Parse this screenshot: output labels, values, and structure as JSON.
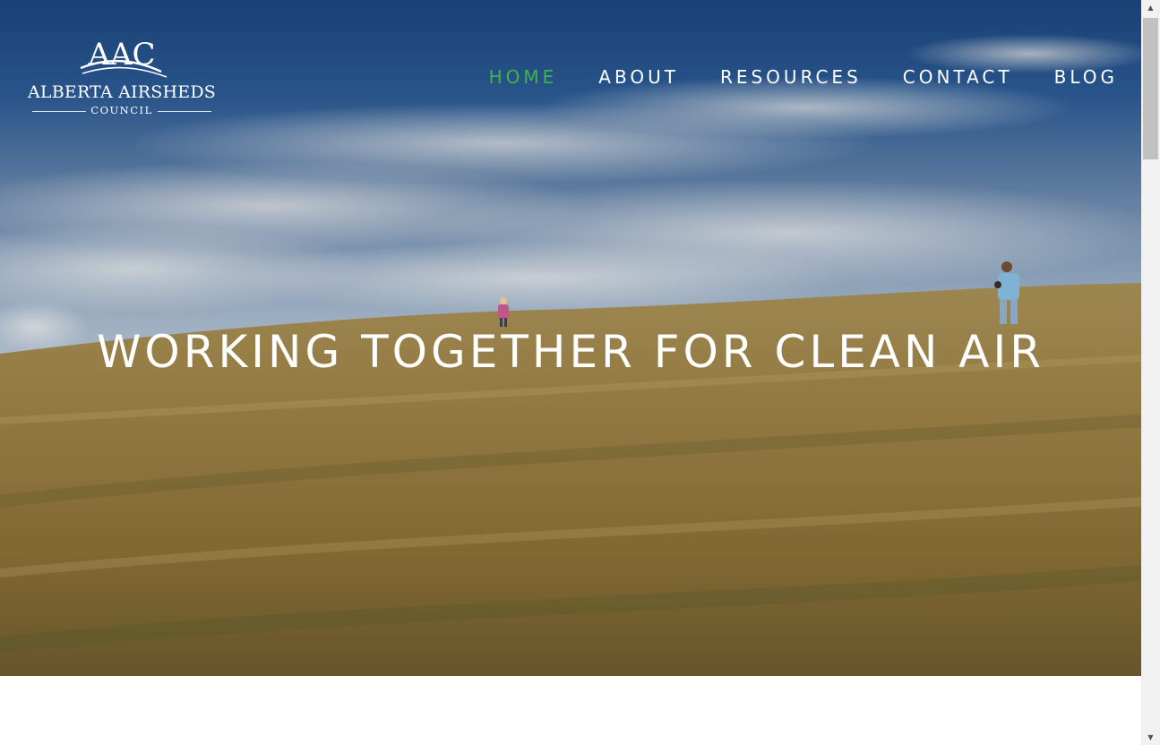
{
  "logo": {
    "monogram": "AAC",
    "name_line1": "ALBERTA AIRSHEDS",
    "name_line2": "COUNCIL"
  },
  "nav": {
    "items": [
      {
        "label": "HOME",
        "active": true
      },
      {
        "label": "ABOUT",
        "active": false
      },
      {
        "label": "RESOURCES",
        "active": false
      },
      {
        "label": "CONTACT",
        "active": false
      },
      {
        "label": "BLOG",
        "active": false
      }
    ],
    "active_color": "#44b24c",
    "text_color": "#ffffff"
  },
  "hero": {
    "headline": "WORKING TOGETHER FOR CLEAN AIR",
    "image": "sky-and-wheat-field-with-children"
  },
  "scrollbar": {
    "up_icon": "scroll-up-arrow-icon",
    "down_icon": "scroll-down-arrow-icon"
  }
}
